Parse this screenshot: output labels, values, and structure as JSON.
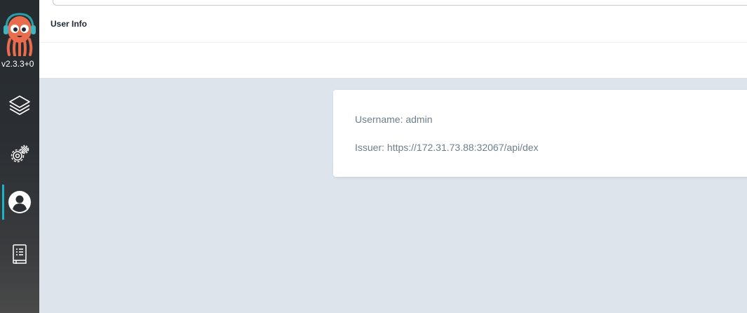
{
  "app": {
    "version": "v2.3.3+0",
    "logo_icon": "argo-octopus-logo"
  },
  "sidebar": {
    "items": [
      {
        "name": "applications",
        "icon": "layers-icon",
        "active": false
      },
      {
        "name": "settings",
        "icon": "gears-icon",
        "active": false
      },
      {
        "name": "user-info",
        "icon": "user-circle-icon",
        "active": true
      },
      {
        "name": "documentation",
        "icon": "book-icon",
        "active": false
      }
    ],
    "active_color": "#1ab4c8"
  },
  "header": {
    "title": "User Info"
  },
  "user_info": {
    "username_label": "Username: admin",
    "issuer_label": "Issuer: https://172.31.73.88:32067/api/dex"
  }
}
